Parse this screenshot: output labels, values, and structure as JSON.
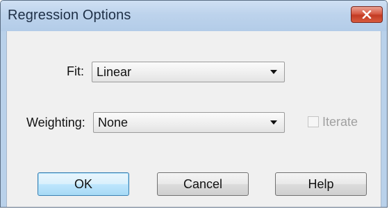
{
  "window": {
    "title": "Regression Options"
  },
  "form": {
    "fit_label": "Fit:",
    "fit_value": "Linear",
    "weighting_label": "Weighting:",
    "weighting_value": "None",
    "iterate_label": "Iterate",
    "iterate_checked": false,
    "iterate_enabled": false
  },
  "buttons": {
    "ok": "OK",
    "cancel": "Cancel",
    "help": "Help"
  },
  "icons": {
    "close": "close-icon",
    "dropdown": "chevron-down-icon"
  },
  "colors": {
    "titlebar": "#b9d1ea",
    "close_button": "#c74a33",
    "client_background": "#f0f0f0",
    "default_button_border": "#3c7fb1",
    "disabled_text": "#a0a0a0"
  }
}
